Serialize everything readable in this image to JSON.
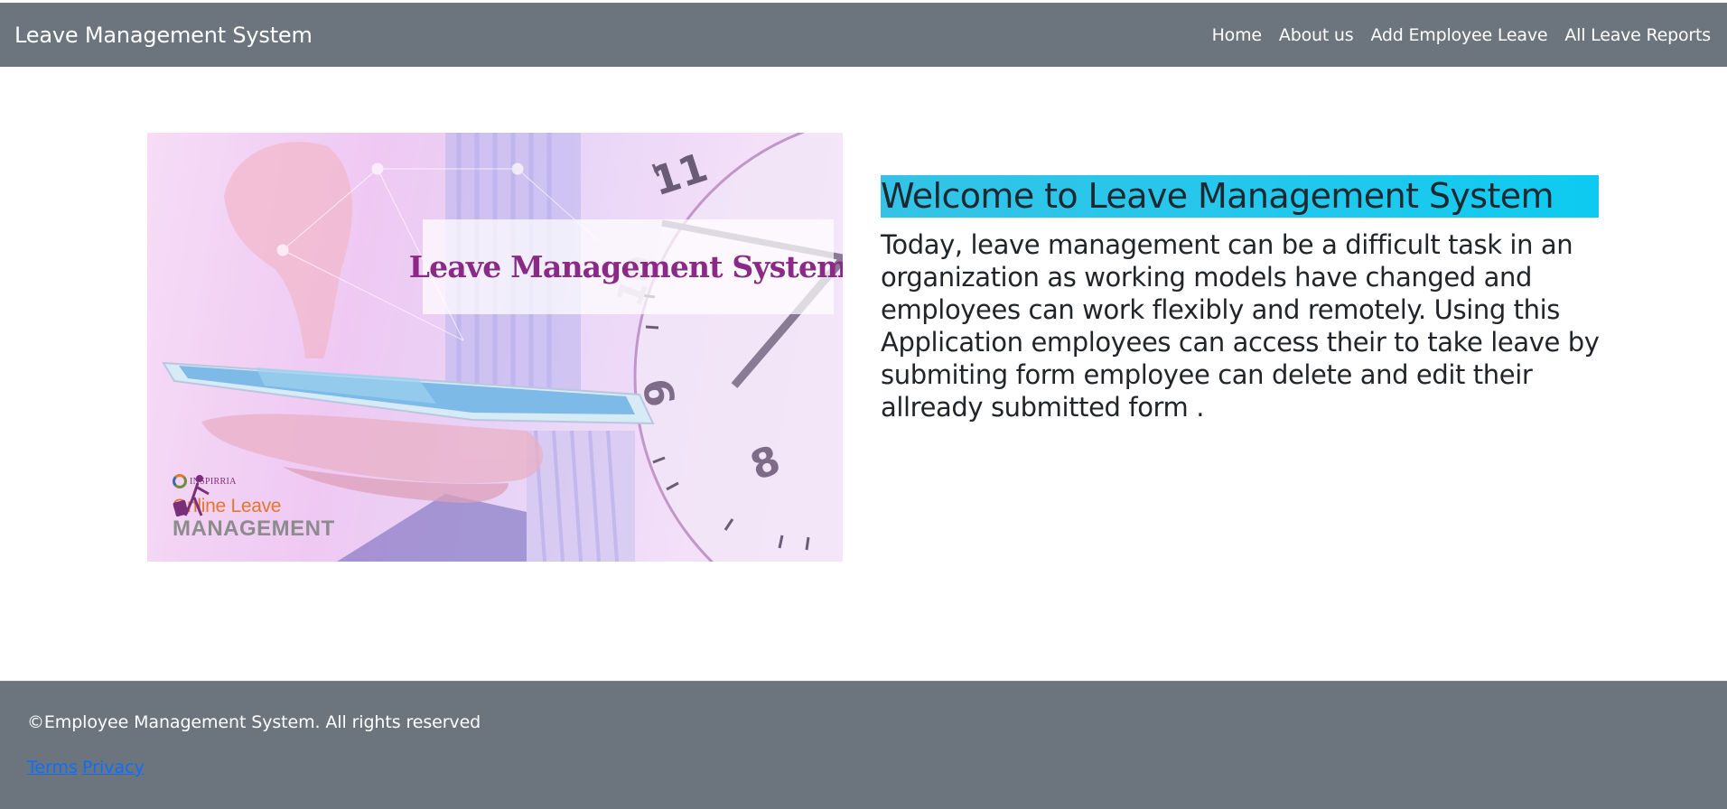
{
  "navbar": {
    "brand": "Leave Management System",
    "links": [
      "Home",
      "About us",
      "Add Employee Leave",
      "All Leave Reports"
    ]
  },
  "hero": {
    "banner_text": "Leave Management System",
    "logo_brand": "INSPIRRIA",
    "logo_line1": "Online Leave",
    "logo_line2": "MANAGEMENT",
    "clock_numbers": [
      "11",
      "10",
      "9",
      "8"
    ]
  },
  "main": {
    "heading": "Welcome to Leave Management System",
    "intro_lines": [
      "Today, leave management can be a difficult task in an",
      "organization as working models have changed and",
      "employees can work flexibly and remotely. Using this",
      "Application employees can access their to take leave by",
      "submiting form employee can delete and edit their",
      "allready submitted form ."
    ]
  },
  "footer": {
    "copyright": "©Employee Management System. All rights reserved",
    "links": [
      "Terms",
      "Privacy"
    ]
  },
  "colors": {
    "navbar_bg": "#6c757d",
    "heading_highlight": "#0dcaf0",
    "link": "#0d6efd",
    "banner_text": "#8a2a86"
  }
}
